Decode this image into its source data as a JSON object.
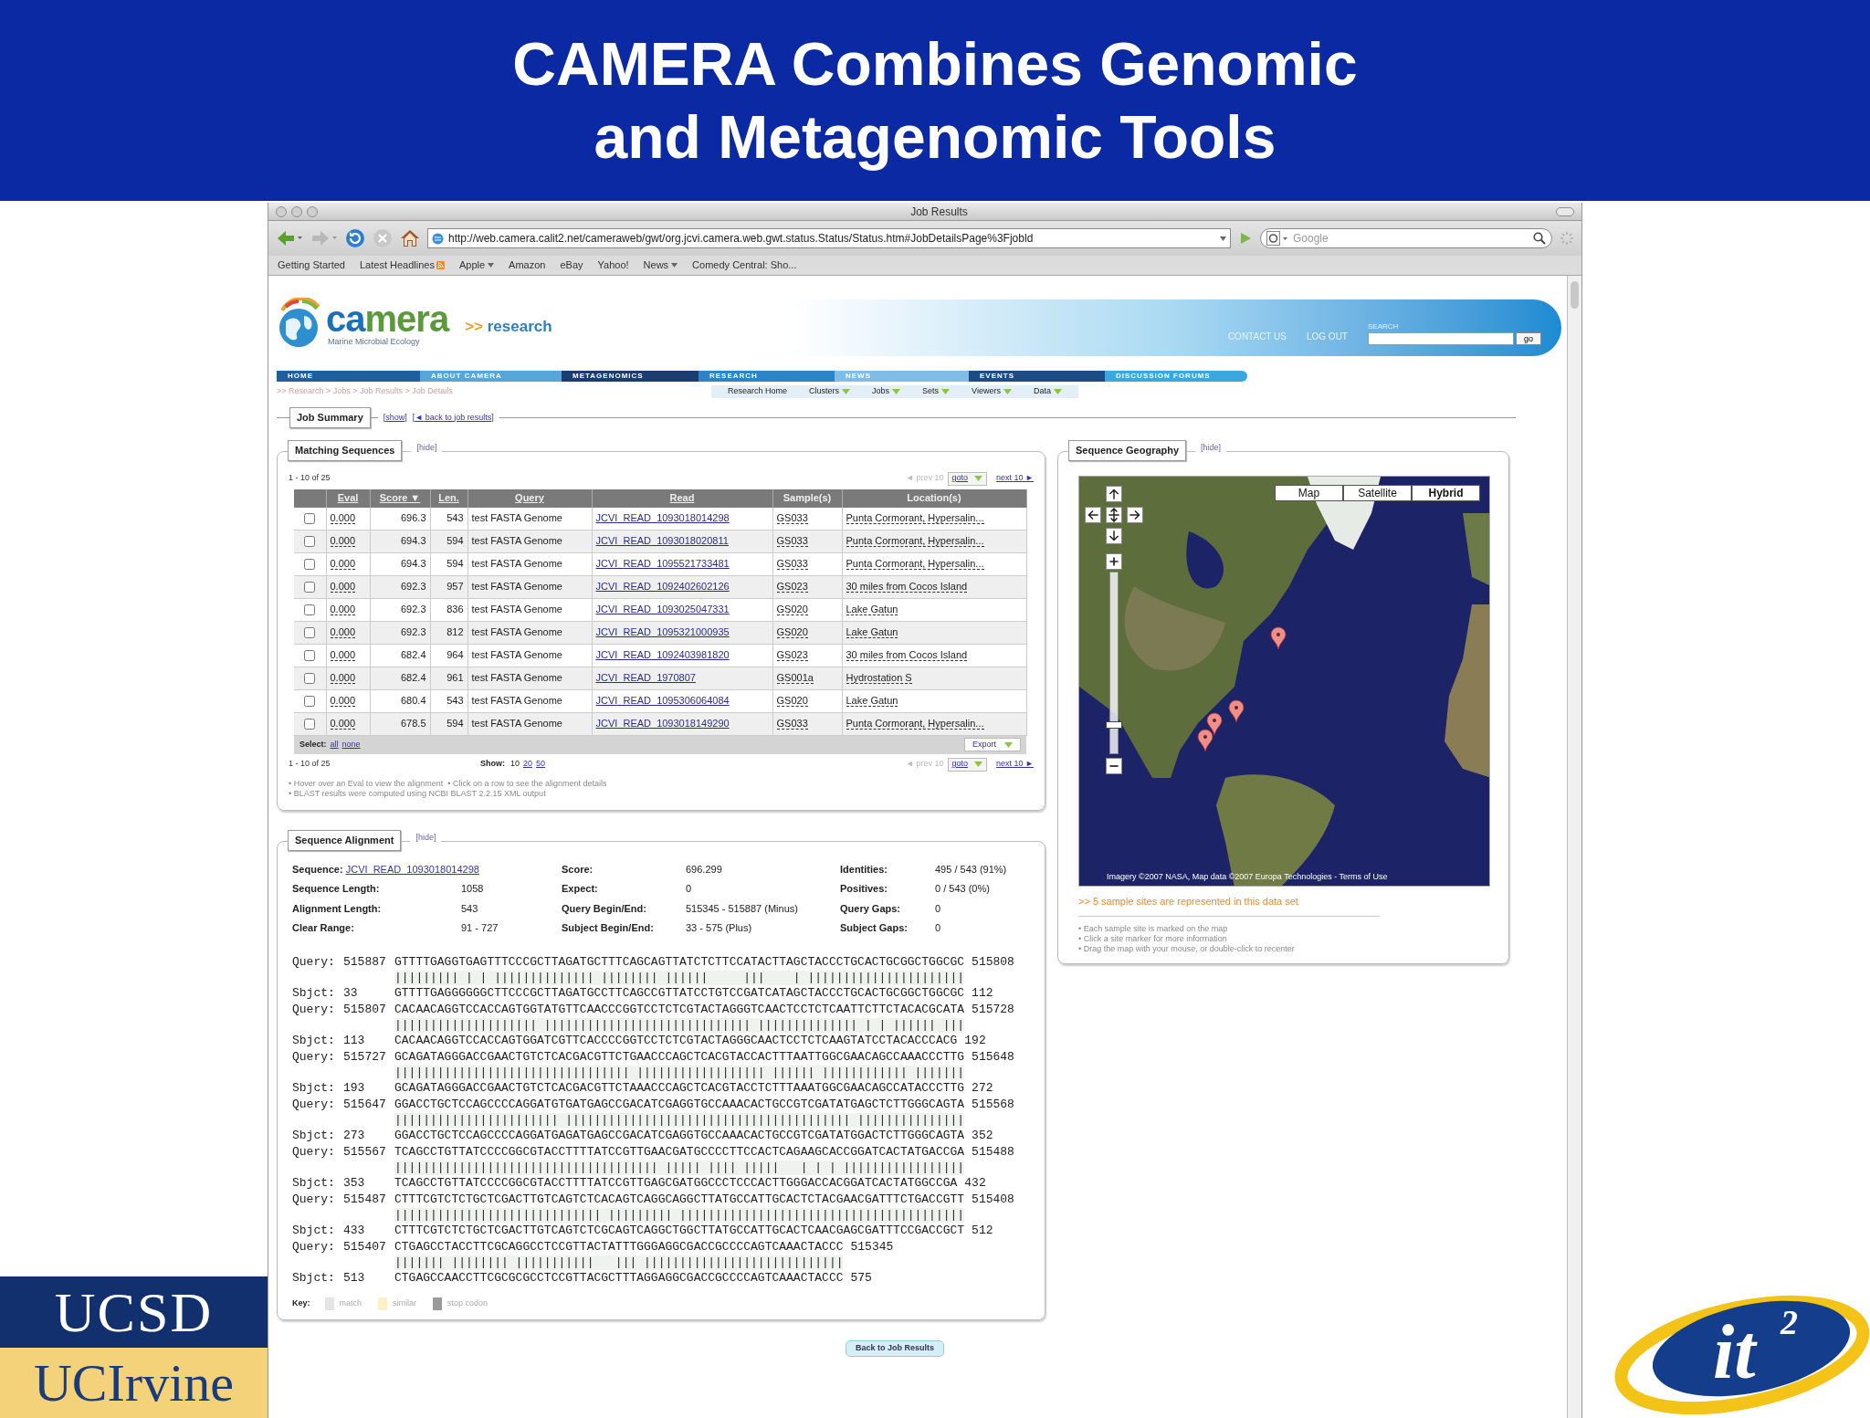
{
  "slide": {
    "title_lines": [
      "CAMERA Combines Genomic",
      "and Metagenomic Tools"
    ]
  },
  "browser": {
    "title": "Job Results",
    "url": "http://web.camera.calit2.net/cameraweb/gwt/org.jcvi.camera.web.gwt.status.Status/Status.htm#JobDetailsPage%3Fjobld",
    "search_placeholder": "Google",
    "bookmarks": [
      {
        "label": "Getting Started",
        "kind": "plain"
      },
      {
        "label": "Latest Headlines",
        "kind": "feed"
      },
      {
        "label": "Apple",
        "kind": "menu"
      },
      {
        "label": "Amazon",
        "kind": "plain"
      },
      {
        "label": "eBay",
        "kind": "plain"
      },
      {
        "label": "Yahoo!",
        "kind": "plain"
      },
      {
        "label": "News",
        "kind": "menu"
      },
      {
        "label": "Comedy Central: Sho...",
        "kind": "plain"
      }
    ]
  },
  "site": {
    "logo": {
      "lead": "ca",
      "rest": "mera"
    },
    "tagline": "Marine Microbial Ecology",
    "section_prefix": ">>",
    "section": "research",
    "header_links": [
      "CONTACT US",
      "LOG OUT"
    ],
    "search_label": "SEARCH",
    "search_button": "go",
    "nav": [
      {
        "label": "HOME",
        "color": "#1f5f9e"
      },
      {
        "label": "ABOUT CAMERA",
        "color": "#56a6d9"
      },
      {
        "label": "METAGENOMICS",
        "color": "#1b3d70"
      },
      {
        "label": "RESEARCH",
        "color": "#2a84c6"
      },
      {
        "label": "NEWS",
        "color": "#7fbde6"
      },
      {
        "label": "EVENTS",
        "color": "#1d4c84"
      },
      {
        "label": "DISCUSSION FORUMS",
        "color": "#3ba7df"
      }
    ],
    "breadcrumb": ">> Research > Jobs > Job Results > Job Details",
    "subnav": [
      {
        "label": "Research Home",
        "menu": false
      },
      {
        "label": "Clusters",
        "menu": true
      },
      {
        "label": "Jobs",
        "menu": true
      },
      {
        "label": "Sets",
        "menu": true
      },
      {
        "label": "Viewers",
        "menu": true
      },
      {
        "label": "Data",
        "menu": true
      }
    ]
  },
  "job_summary": {
    "title": "Job Summary",
    "links": [
      "[show]",
      "[◄ back to job results]"
    ]
  },
  "matching": {
    "title": "Matching Sequences",
    "hide": "[hide]",
    "range": "1 - 10 of 25",
    "range_bottom": "1 - 10 of 25",
    "pager_top": {
      "prev": "◄ prev 10",
      "goto": "goto",
      "next": "next 10 ►"
    },
    "pager_bottom": {
      "prev": "◄ prev 10",
      "goto": "goto",
      "next": "next 10 ►"
    },
    "columns": [
      {
        "label": "Eval",
        "sortable": true
      },
      {
        "label": "Score ▼",
        "sortable": true
      },
      {
        "label": "Len.",
        "sortable": true
      },
      {
        "label": "Query",
        "sortable": true
      },
      {
        "label": "Read",
        "sortable": true
      },
      {
        "label": "Sample(s)",
        "sortable": false
      },
      {
        "label": "Location(s)",
        "sortable": false
      }
    ],
    "rows": [
      {
        "checked": false,
        "eval": "0.000",
        "score": "696.3",
        "len": "543",
        "query": "test FASTA Genome",
        "read": "JCVI_READ_1093018014298",
        "sample": "GS033",
        "location": "Punta Cormorant, Hypersalin..."
      },
      {
        "checked": false,
        "eval": "0.000",
        "score": "694.3",
        "len": "594",
        "query": "test FASTA Genome",
        "read": "JCVI_READ_1093018020811",
        "sample": "GS033",
        "location": "Punta Cormorant, Hypersalin..."
      },
      {
        "checked": false,
        "eval": "0.000",
        "score": "694.3",
        "len": "594",
        "query": "test FASTA Genome",
        "read": "JCVI_READ_1095521733481",
        "sample": "GS033",
        "location": "Punta Cormorant, Hypersalin..."
      },
      {
        "checked": false,
        "eval": "0.000",
        "score": "692.3",
        "len": "957",
        "query": "test FASTA Genome",
        "read": "JCVI_READ_1092402602126",
        "sample": "GS023",
        "location": "30 miles from Cocos Island"
      },
      {
        "checked": false,
        "eval": "0.000",
        "score": "692.3",
        "len": "836",
        "query": "test FASTA Genome",
        "read": "JCVI_READ_1093025047331",
        "sample": "GS020",
        "location": "Lake Gatun"
      },
      {
        "checked": false,
        "eval": "0.000",
        "score": "692.3",
        "len": "812",
        "query": "test FASTA Genome",
        "read": "JCVI_READ_1095321000935",
        "sample": "GS020",
        "location": "Lake Gatun"
      },
      {
        "checked": false,
        "eval": "0.000",
        "score": "682.4",
        "len": "964",
        "query": "test FASTA Genome",
        "read": "JCVI_READ_1092403981820",
        "sample": "GS023",
        "location": "30 miles from Cocos Island"
      },
      {
        "checked": false,
        "eval": "0.000",
        "score": "682.4",
        "len": "961",
        "query": "test FASTA Genome",
        "read": "JCVI_READ_1970807",
        "sample": "GS001a",
        "location": "Hydrostation S"
      },
      {
        "checked": false,
        "eval": "0.000",
        "score": "680.4",
        "len": "543",
        "query": "test FASTA Genome",
        "read": "JCVI_READ_1095306064084",
        "sample": "GS020",
        "location": "Lake Gatun"
      },
      {
        "checked": false,
        "eval": "0.000",
        "score": "678.5",
        "len": "594",
        "query": "test FASTA Genome",
        "read": "JCVI_READ_1093018149290",
        "sample": "GS033",
        "location": "Punta Cormorant, Hypersalin..."
      }
    ],
    "select_label": "Select:",
    "select_links": [
      "all",
      "none"
    ],
    "export": "Export",
    "show_label": "Show:",
    "show_options": [
      {
        "label": "10",
        "selected": true
      },
      {
        "label": "20",
        "selected": false
      },
      {
        "label": "50",
        "selected": false
      }
    ],
    "notes": [
      "• Hover over an Eval to view the alignment  • Click on a row to see the alignment details",
      "• BLAST results were computed using NCBI BLAST 2.2.15 XML output"
    ]
  },
  "geography": {
    "title": "Sequence Geography",
    "hide": "[hide]",
    "map_types": [
      {
        "label": "Map",
        "selected": false
      },
      {
        "label": "Satellite",
        "selected": false
      },
      {
        "label": "Hybrid",
        "selected": true
      }
    ],
    "zoom": {
      "level": 0.14
    },
    "attribution": "Imagery ©2007 NASA, Map data ©2007 Europa Technologies - Terms of Use",
    "summary": ">> 5 sample sites are represented in this data set",
    "notes": [
      "• Each sample site is marked on the map",
      "• Click a site marker for more information",
      "• Drag the map with your mouse, or double-click to recenter"
    ]
  },
  "alignment": {
    "title": "Sequence Alignment",
    "hide": "[hide]",
    "info": [
      [
        {
          "label": "Sequence:",
          "value": "JCVI_READ_1093018014298",
          "kind": "link"
        },
        {
          "label": "Score:",
          "value": "696.299",
          "kind": "text"
        },
        {
          "label": "Identities:",
          "value": "495 / 543 (91%)",
          "kind": "text"
        }
      ],
      [
        {
          "label": "Sequence Length:",
          "value": "1058",
          "kind": "text"
        },
        {
          "label": "Expect:",
          "value": "0",
          "kind": "text"
        },
        {
          "label": "Positives:",
          "value": "0 / 543 (0%)",
          "kind": "text"
        }
      ],
      [
        {
          "label": "Alignment Length:",
          "value": "543",
          "kind": "text"
        },
        {
          "label": "Query Begin/End:",
          "value": "515345 - 515887 (Minus)",
          "kind": "text"
        },
        {
          "label": "Query Gaps:",
          "value": "0",
          "kind": "text"
        }
      ],
      [
        {
          "label": "Clear Range:",
          "value": "91 - 727",
          "kind": "text"
        },
        {
          "label": "Subject Begin/End:",
          "value": "33 - 575 (Plus)",
          "kind": "text"
        },
        {
          "label": "Subject Gaps:",
          "value": "0",
          "kind": "text"
        }
      ]
    ],
    "blocks": [
      {
        "q_label": "Query:",
        "q_start": "515887",
        "q_seq": "GTTTTGAGGTGAGTTTCCCGCTTAGATGCTTTCAGCAGTTATCTCTTCCATACTTAGCTACCCTGCACTGCGGCTGGCGC",
        "q_end": "515808",
        "mid": "||||||||| | | |||||||||||||| |||||||| ||||||     |||    | ||||||||||||||||||||||",
        "s_label": "Sbjct:",
        "s_start": "33",
        "s_seq": "GTTTTGAGGGGGGCTTCCCGCTTAGATGCCTTCAGCCGTTATCCTGTCCGATCATAGCTACCCTGCACTGCGGCTGGCGC",
        "s_end": "112"
      },
      {
        "q_label": "Query:",
        "q_start": "515807",
        "q_seq": "CACAACAGGTCCACCAGTGGTATGTTCAACCCGGTCCTCTCGTACTAGGGTCAACTCCTCTCAATTCTTCTACACGCATA",
        "q_end": "515728",
        "mid": "|||||||||||||||||||| ||||||||||||||||||||||||||||| |||||||||||||| | | |||||| |||",
        "s_label": "Sbjct:",
        "s_start": "113",
        "s_seq": "CACAACAGGTCCACCAGTGGATCGTTCACCCCGGTCCTCTCGTACTAGGGCAACTCCTCTCAAGTATCCTACACCCACG",
        "s_end": "192"
      },
      {
        "q_label": "Query:",
        "q_start": "515727",
        "q_seq": "GCAGATAGGGACCGAACTGTCTCACGACGTTCTGAACCCAGCTCACGTACCACTTTAATTGGCGAACAGCCAAACCCTTG",
        "q_end": "515648",
        "mid": "||||||||||||||||||||||||||||||||| |||||||||||||||||| |||||| |||||||||||| |||||||",
        "s_label": "Sbjct:",
        "s_start": "193",
        "s_seq": "GCAGATAGGGACCGAACTGTCTCACGACGTTCTAAACCCAGCTCACGTACCTCTTTAAATGGCGAACAGCCATACCCTTG",
        "s_end": "272"
      },
      {
        "q_label": "Query:",
        "q_start": "515647",
        "q_seq": "GGACCTGCTCCAGCCCCAGGATGTGATGAGCCGACATCGAGGTGCCAAACACTGCCGTCGATATGAGCTCTTGGGCAGTA",
        "q_end": "515568",
        "mid": "||||||||||||||||||||||| |||||||||||||||||||||||||||||||||||||||| |||||||||||||||",
        "s_label": "Sbjct:",
        "s_start": "273",
        "s_seq": "GGACCTGCTCCAGCCCCAGGATGAGATGAGCCGACATCGAGGTGCCAAACACTGCCGTCGATATGGACTCTTGGGCAGTA",
        "s_end": "352"
      },
      {
        "q_label": "Query:",
        "q_start": "515567",
        "q_seq": "TCAGCCTGTTATCCCCGGCGTACCTTTTATCCGTTGAACGATGCCCCTTCCACTCAGAAGCACCGGATCACTATGACCGA",
        "q_end": "515488",
        "mid": "||||||||||||||||||||||||||||||||||||| ||||| |||| |||||   | | | |||||||||||||||||",
        "s_label": "Sbjct:",
        "s_start": "353",
        "s_seq": "TCAGCCTGTTATCCCCGGCGTACCTTTTATCCGTTGAGCGATGGCCCTCCCACTTGGGACCACGGATCACTATGGCCGA",
        "s_end": "432"
      },
      {
        "q_label": "Query:",
        "q_start": "515487",
        "q_seq": "CTTTCGTCTCTGCTCGACTTGTCAGTCTCACAGTCAGGCAGGCTTATGCCATTGCACTCTACGAACGATTTCTGACCGTT",
        "q_end": "515408",
        "mid": "||||||||||||||||||||||||||||| ||||||||| ||||||||||||||||||||||||||||||||||||||||",
        "s_label": "Sbjct:",
        "s_start": "433",
        "s_seq": "CTTTCGTCTCTGCTCGACTTGTCAGTCTCGCAGTCAGGCTGGCTTATGCCATTGCACTCAACGAGCGATTTCCGACCGCT",
        "s_end": "512"
      },
      {
        "q_label": "Query:",
        "q_start": "515407",
        "q_seq": "CTGAGCCTACCTTCGCAGGCCTCCGTTACTATTTGGGAGGCGACCGCCCCAGTCAAACTACCC",
        "q_end": "515345",
        "mid": "||||||| |||||||| |||||||||||   ||| ||||||||||||||||||||||||||||",
        "s_label": "Sbjct:",
        "s_start": "513",
        "s_seq": "CTGAGCCAACCTTCGCGCGCCTCCGTTACGCTTTAGGAGGCGACCGCCCCAGTCAAACTACCC",
        "s_end": "575"
      }
    ],
    "key_label": "Key:",
    "key": [
      {
        "label": "match",
        "color": "#e4e4e4"
      },
      {
        "label": "similar",
        "color": "#fbf0c8"
      },
      {
        "label": "stop codon",
        "color": "#9a9a9a"
      }
    ]
  },
  "back_button": "Back to Job Results",
  "logos": {
    "ucsd": "UCSD",
    "uci": "UCIrvine",
    "it": "it",
    "it_sup": "2"
  }
}
